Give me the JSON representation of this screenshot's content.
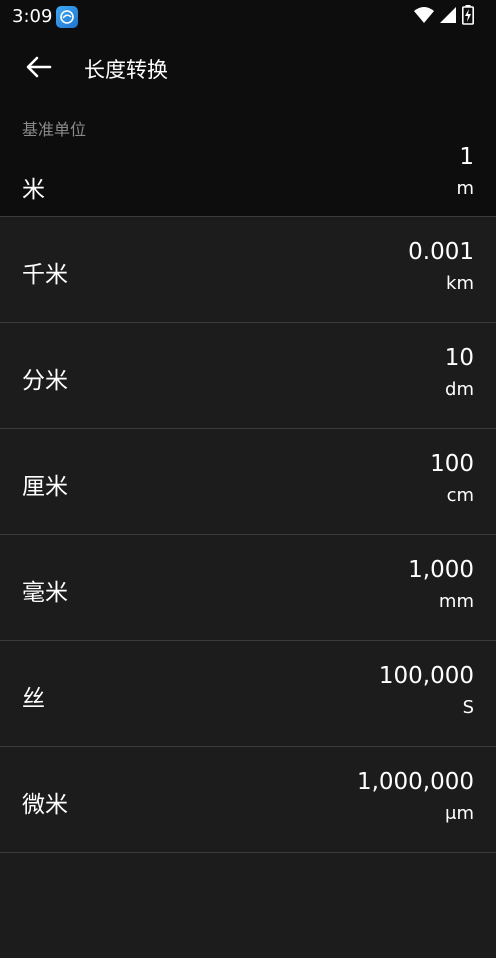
{
  "status_bar": {
    "time": "3:09"
  },
  "header": {
    "title": "长度转换"
  },
  "base": {
    "label": "基准单位",
    "name": "米",
    "value": "1",
    "symbol": "m"
  },
  "units": [
    {
      "name": "千米",
      "value": "0.001",
      "symbol": "km"
    },
    {
      "name": "分米",
      "value": "10",
      "symbol": "dm"
    },
    {
      "name": "厘米",
      "value": "100",
      "symbol": "cm"
    },
    {
      "name": "毫米",
      "value": "1,000",
      "symbol": "mm"
    },
    {
      "name": "丝",
      "value": "100,000",
      "symbol": "S"
    },
    {
      "name": "微米",
      "value": "1,000,000",
      "symbol": "μm"
    },
    {
      "name": "",
      "value": "",
      "symbol": ""
    }
  ],
  "icons": [
    "app-icon",
    "wifi-icon",
    "signal-icon",
    "battery-charging-icon",
    "back-arrow-icon"
  ]
}
